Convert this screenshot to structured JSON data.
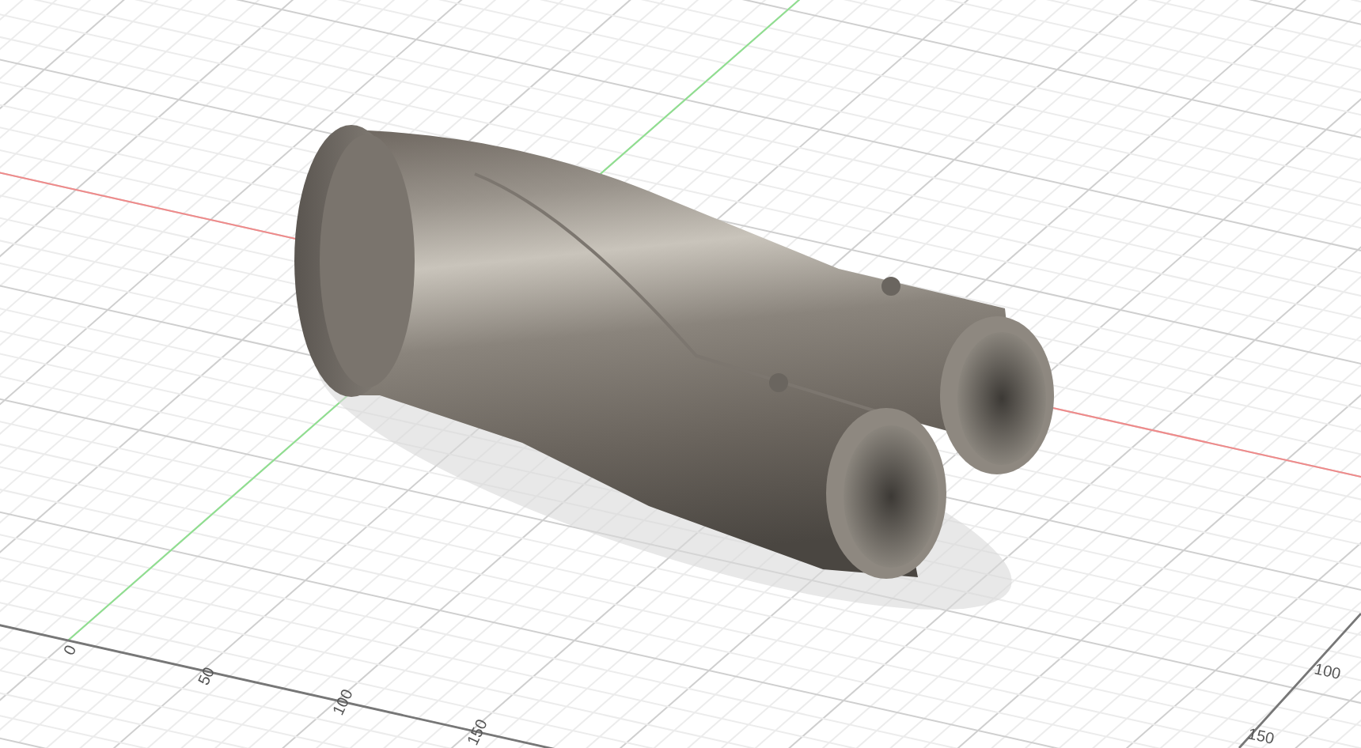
{
  "viewport": {
    "bottom_ruler": [
      "0",
      "50",
      "100",
      "150"
    ],
    "right_ruler": [
      "100",
      "150"
    ]
  }
}
